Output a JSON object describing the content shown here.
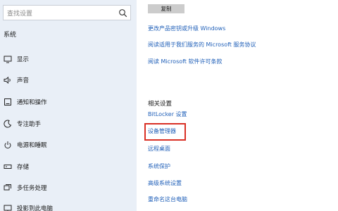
{
  "search": {
    "placeholder": "查找设置"
  },
  "sidebar": {
    "title": "系统",
    "items": [
      {
        "label": "显示",
        "icon": "display-icon"
      },
      {
        "label": "声音",
        "icon": "speaker-icon"
      },
      {
        "label": "通知和操作",
        "icon": "notification-icon"
      },
      {
        "label": "专注助手",
        "icon": "focus-assist-icon"
      },
      {
        "label": "电源和睡眠",
        "icon": "power-icon"
      },
      {
        "label": "存储",
        "icon": "storage-icon"
      },
      {
        "label": "多任务处理",
        "icon": "multitasking-icon"
      },
      {
        "label": "投影到此电脑",
        "icon": "projecting-icon"
      }
    ]
  },
  "main": {
    "copy_label": "复制",
    "links": [
      "更改产品密钥或升级 Windows",
      "阅读适用于我们服务的 Microsoft 服务协议",
      "阅读 Microsoft 软件许可条款"
    ],
    "related_title": "相关设置",
    "related_links": [
      "BitLocker 设置",
      "设备管理器",
      "远程桌面",
      "系统保护",
      "高级系统设置",
      "重命名这台电脑"
    ]
  },
  "colors": {
    "link": "#1f5fb8",
    "sidebar_bg": "#e9eff7",
    "highlight": "#d93025"
  }
}
